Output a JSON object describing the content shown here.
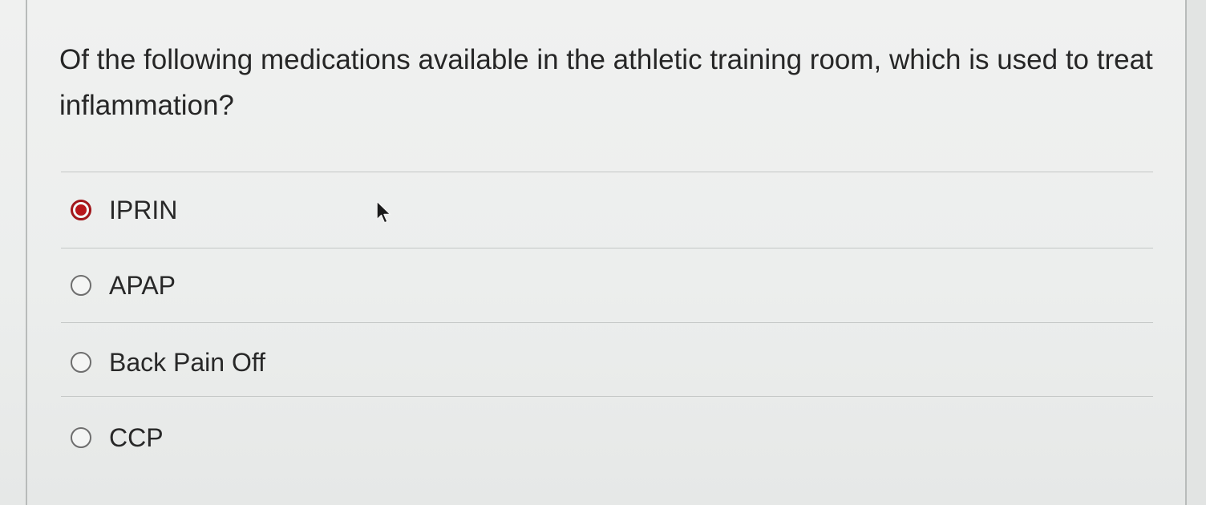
{
  "question": {
    "text": "Of the following medications available in the athletic training room, which is used to treat inflammation?"
  },
  "options": [
    {
      "label": "IPRIN",
      "selected": true
    },
    {
      "label": "APAP",
      "selected": false
    },
    {
      "label": "Back Pain Off",
      "selected": false
    },
    {
      "label": "CCP",
      "selected": false
    }
  ],
  "colors": {
    "selected_radio": "#b8161b",
    "text": "#262626",
    "background": "#eceeed"
  }
}
